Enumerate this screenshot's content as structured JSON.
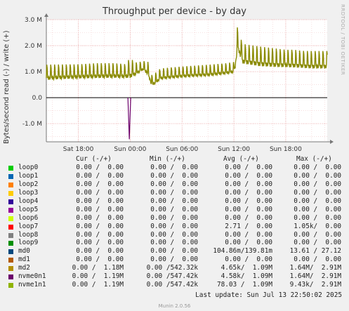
{
  "title": "Throughput per device - by day",
  "watermark": "RRDTOOL / TOBI OETIKER",
  "ylabel": "Bytes/second read (-) / write (+)",
  "chart_data": {
    "type": "line",
    "title": "Throughput per device - by day",
    "ylabel": "Bytes/second read (-) / write (+)",
    "ylim": [
      -1700000,
      3000000
    ],
    "y_ticks": [
      {
        "value": -1000000,
        "label": "-1.0 M"
      },
      {
        "value": 0,
        "label": "0.0"
      },
      {
        "value": 1000000,
        "label": "1.0 M"
      },
      {
        "value": 2000000,
        "label": "2.0 M"
      },
      {
        "value": 3000000,
        "label": "3.0 M"
      }
    ],
    "x_ticks": [
      {
        "hour": 18,
        "label": "Sat 18:00"
      },
      {
        "hour": 24,
        "label": "Sun 00:00"
      },
      {
        "hour": 30,
        "label": "Sun 06:00"
      },
      {
        "hour": 36,
        "label": "Sun 12:00"
      },
      {
        "hour": 42,
        "label": "Sun 18:00"
      }
    ],
    "xlim_hours": [
      14.3,
      46.8
    ],
    "grid": true,
    "series": [
      {
        "name": "nvme1n1",
        "color": "#8a8a00",
        "write_x": [
          14.3,
          16,
          18,
          20,
          22,
          23.5,
          24,
          24.5,
          25.5,
          26,
          26.5,
          27,
          27.5,
          29,
          31,
          33,
          35,
          36,
          36.2,
          36.4,
          37,
          38,
          39,
          40,
          41,
          42,
          43,
          44,
          45,
          46,
          46.8
        ],
        "write_base": [
          750000.0,
          780000.0,
          800000.0,
          820000.0,
          830000.0,
          820000.0,
          850000.0,
          900000.0,
          1100000.0,
          950000.0,
          500000.0,
          600000.0,
          750000.0,
          800000.0,
          850000.0,
          880000.0,
          950000.0,
          1000000.0,
          1300000.0,
          2000000.0,
          1400000.0,
          1350000.0,
          1300000.0,
          1280000.0,
          1260000.0,
          1250000.0,
          1240000.0,
          1220000.0,
          1200000.0,
          1200000.0,
          1200000.0
        ],
        "write_peak": [
          1450000.0,
          1450000.0,
          1450000.0,
          1500000.0,
          1500000.0,
          1450000.0,
          1800000.0,
          1500000.0,
          1500000.0,
          1600000.0,
          1000000.0,
          1100000.0,
          1250000.0,
          1300000.0,
          1350000.0,
          1400000.0,
          1450000.0,
          1500000.0,
          2500000.0,
          2950000.0,
          2300000.0,
          2250000.0,
          2200000.0,
          2150000.0,
          2100000.0,
          2050000.0,
          2050000.0,
          2000000.0,
          2000000.0,
          2000000.0,
          2000000.0
        ]
      },
      {
        "name": "md0",
        "color": "#006060",
        "note": "read spike",
        "spike_hour": 23.9,
        "spike_value": -1600000
      }
    ]
  },
  "legend": {
    "header_cur": "Cur (-/+)",
    "header_min": "Min (-/+)",
    "header_avg": "Avg (-/+)",
    "header_max": "Max (-/+)",
    "rows": [
      {
        "name": "loop0",
        "color": "#00cc00",
        "cur": "0.00 /  0.00",
        "min": "0.00 /  0.00",
        "avg": "0.00 /  0.00",
        "max": "0.00 /  0.00"
      },
      {
        "name": "loop1",
        "color": "#0066b3",
        "cur": "0.00 /  0.00",
        "min": "0.00 /  0.00",
        "avg": "0.00 /  0.00",
        "max": "0.00 /  0.00"
      },
      {
        "name": "loop2",
        "color": "#ff8000",
        "cur": "0.00 /  0.00",
        "min": "0.00 /  0.00",
        "avg": "0.00 /  0.00",
        "max": "0.00 /  0.00"
      },
      {
        "name": "loop3",
        "color": "#ffcc00",
        "cur": "0.00 /  0.00",
        "min": "0.00 /  0.00",
        "avg": "0.00 /  0.00",
        "max": "0.00 /  0.00"
      },
      {
        "name": "loop4",
        "color": "#330099",
        "cur": "0.00 /  0.00",
        "min": "0.00 /  0.00",
        "avg": "0.00 /  0.00",
        "max": "0.00 /  0.00"
      },
      {
        "name": "loop5",
        "color": "#990099",
        "cur": "0.00 /  0.00",
        "min": "0.00 /  0.00",
        "avg": "0.00 /  0.00",
        "max": "0.00 /  0.00"
      },
      {
        "name": "loop6",
        "color": "#ccff00",
        "cur": "0.00 /  0.00",
        "min": "0.00 /  0.00",
        "avg": "0.00 /  0.00",
        "max": "0.00 /  0.00"
      },
      {
        "name": "loop7",
        "color": "#ff0000",
        "cur": "0.00 /  0.00",
        "min": "0.00 /  0.00",
        "avg": "2.71 /  0.00",
        "max": "1.05k/  0.00"
      },
      {
        "name": "loop8",
        "color": "#808080",
        "cur": "0.00 /  0.00",
        "min": "0.00 /  0.00",
        "avg": "0.00 /  0.00",
        "max": "0.00 /  0.00"
      },
      {
        "name": "loop9",
        "color": "#008f00",
        "cur": "0.00 /  0.00",
        "min": "0.00 /  0.00",
        "avg": "0.00 /  0.00",
        "max": "0.00 /  0.00"
      },
      {
        "name": "md0",
        "color": "#00487d",
        "cur": "0.00 /  0.00",
        "min": "0.00 /  0.00",
        "avg": "104.86m/139.81m",
        "max": "13.61 / 27.12"
      },
      {
        "name": "md1",
        "color": "#b35a00",
        "cur": "0.00 /  0.00",
        "min": "0.00 /  0.00",
        "avg": "0.00 /  0.00",
        "max": "0.00 /  0.00"
      },
      {
        "name": "md2",
        "color": "#b38f00",
        "cur": "0.00 /  1.18M",
        "min": "0.00 /542.32k",
        "avg": "4.65k/  1.09M",
        "max": "1.64M/  2.91M"
      },
      {
        "name": "nvme0n1",
        "color": "#6b006b",
        "cur": "0.00 /  1.19M",
        "min": "0.00 /547.42k",
        "avg": "4.58k/  1.09M",
        "max": "1.64M/  2.91M"
      },
      {
        "name": "nvme1n1",
        "color": "#8fb300",
        "cur": "0.00 /  1.19M",
        "min": "0.00 /547.42k",
        "avg": "78.03 /  1.09M",
        "max": "9.43k/  2.91M"
      }
    ]
  },
  "last_update": "Last update: Sun Jul 13 22:50:02 2025",
  "footer": "Munin 2.0.56"
}
